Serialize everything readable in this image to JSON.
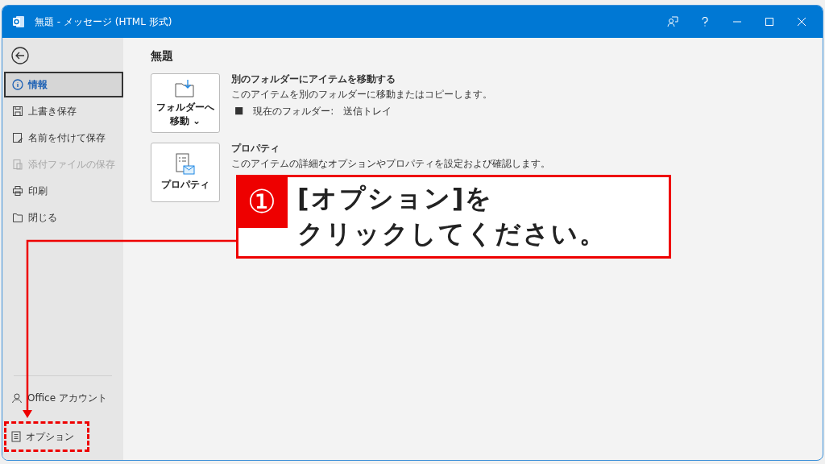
{
  "window": {
    "title": "無題 - メッセージ (HTML 形式)"
  },
  "sidebar": {
    "items": [
      {
        "label": "情報",
        "selected": true,
        "disabled": false
      },
      {
        "label": "上書き保存",
        "selected": false,
        "disabled": false
      },
      {
        "label": "名前を付けて保存",
        "selected": false,
        "disabled": false
      },
      {
        "label": "添付ファイルの保存",
        "selected": false,
        "disabled": true
      },
      {
        "label": "印刷",
        "selected": false,
        "disabled": false
      },
      {
        "label": "閉じる",
        "selected": false,
        "disabled": false
      }
    ],
    "bottom_items": [
      {
        "label": "Office アカウント",
        "highlighted": false
      },
      {
        "label": "オプション",
        "highlighted": true
      }
    ]
  },
  "main": {
    "heading": "無題",
    "sections": [
      {
        "button": "フォルダーへ移動",
        "button_caret": "⌄",
        "title": "別のフォルダーにアイテムを移動する",
        "description": "このアイテムを別のフォルダーに移動またはコピーします。",
        "bullet_mark": "■",
        "bullet": "現在のフォルダー:　送信トレイ"
      },
      {
        "button": "プロパティ",
        "title": "プロパティ",
        "description": "このアイテムの詳細なオプションやプロパティを設定および確認します。"
      }
    ]
  },
  "callout": {
    "number": "①",
    "lines": [
      "[オプション]を",
      "クリックしてください。"
    ]
  }
}
